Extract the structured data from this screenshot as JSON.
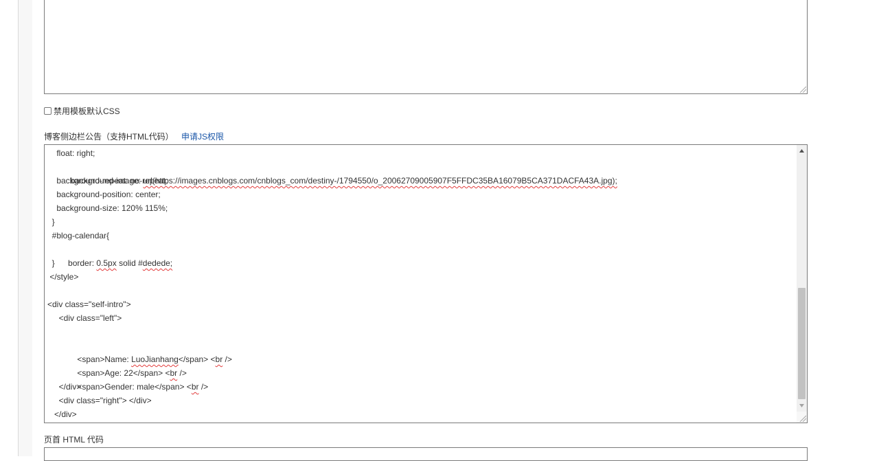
{
  "form": {
    "disable_default_css_label": "禁用模板默认CSS",
    "announcement": {
      "label": "博客侧边栏公告（支持HTML代码）",
      "request_js_link": "申请JS权限"
    },
    "header_html": {
      "label": "页首 HTML 代码"
    }
  },
  "code": {
    "line1": "    float: right;",
    "line2_prefix": "    background-image: ",
    "line2_url": "url(https://images.cnblogs.com/cnblogs_com/destiny-/1794550/o_20062709005907F5FFDC35BA16079B5CA371DACFA43A.jpg);",
    "line3": "    background-repeat: no-repeat;",
    "line4": "    background-position: center;",
    "line5": "    background-size: 120% 115%;",
    "line6": "  }",
    "line7": "  #blog-calendar{",
    "line8_prefix": "   border: ",
    "line8_px": "0.5px",
    "line8_mid": " solid #",
    "line8_color": "dedede;",
    "line9": "  }",
    "line10": " </style>",
    "line11": "",
    "line12": "<div class=\"self-intro\">",
    "line13": "     <div class=\"left\">",
    "line14": "",
    "line15_prefix": "       <span>Name: ",
    "line15_name": "LuoJianhang",
    "line15_suffix": "</span> <",
    "line15_br": "br",
    "line15_end": " />",
    "line16_prefix": "       <span>Age: 22</span> <",
    "line16_br": "br",
    "line16_end": " />",
    "line17_prefix": "       <span>Gender: male</span> <",
    "line17_br": "br",
    "line17_end": " />",
    "line18": "     </div>",
    "line19": "     <div class=\"right\"> </div>",
    "line20": "   </div>"
  },
  "scrollbar": {
    "position_fraction": 0.8
  }
}
